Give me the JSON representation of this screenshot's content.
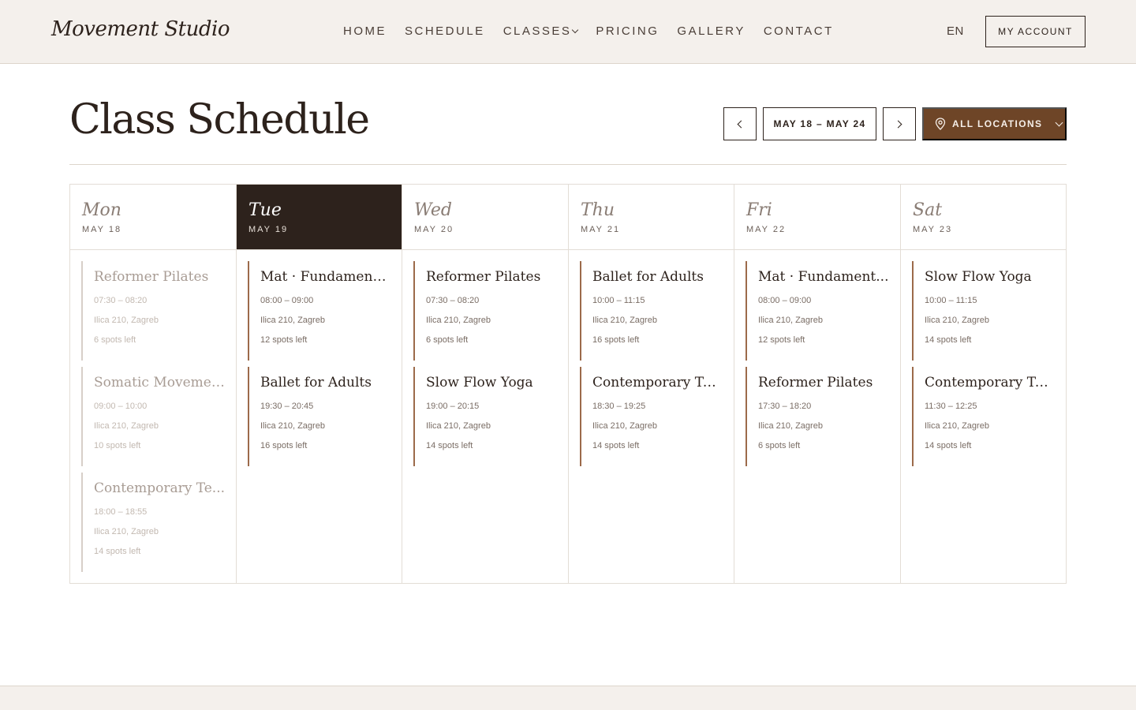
{
  "header": {
    "logo": "Movement Studio",
    "nav": [
      {
        "label": "HOME"
      },
      {
        "label": "SCHEDULE"
      },
      {
        "label": "CLASSES",
        "has_dropdown": true
      },
      {
        "label": "PRICING"
      },
      {
        "label": "GALLERY"
      },
      {
        "label": "CONTACT"
      }
    ],
    "language": "EN",
    "account_label": "MY ACCOUNT"
  },
  "page": {
    "title": "Class Schedule",
    "week_range": "MAY 18 – MAY 24",
    "location_filter": "ALL LOCATIONS",
    "prev_icon": "chevron-left-icon",
    "next_icon": "chevron-right-icon",
    "location_icon": "map-pin-icon"
  },
  "colors": {
    "accent": "#6e4527",
    "active_day_bg": "#2d221c",
    "class_border": "#9c6a4a",
    "header_bg": "#f4f0ec"
  },
  "days": [
    {
      "name": "Mon",
      "date": "MAY 18",
      "active": false,
      "past": true,
      "classes": [
        {
          "title": "Reformer Pilates",
          "time": "07:30 – 08:20",
          "location": "Ilica 210, Zagreb",
          "spots": "6 spots left"
        },
        {
          "title": "Somatic Movement",
          "time": "09:00 – 10:00",
          "location": "Ilica 210, Zagreb",
          "spots": "10 spots left"
        },
        {
          "title": "Contemporary Te...",
          "time": "18:00 – 18:55",
          "location": "Ilica 210, Zagreb",
          "spots": "14 spots left"
        }
      ]
    },
    {
      "name": "Tue",
      "date": "MAY 19",
      "active": true,
      "past": false,
      "classes": [
        {
          "title": "Mat · Fundament...",
          "time": "08:00 – 09:00",
          "location": "Ilica 210, Zagreb",
          "spots": "12 spots left"
        },
        {
          "title": "Ballet for Adults",
          "time": "19:30 – 20:45",
          "location": "Ilica 210, Zagreb",
          "spots": "16 spots left"
        }
      ]
    },
    {
      "name": "Wed",
      "date": "MAY 20",
      "active": false,
      "past": false,
      "classes": [
        {
          "title": "Reformer Pilates",
          "time": "07:30 – 08:20",
          "location": "Ilica 210, Zagreb",
          "spots": "6 spots left"
        },
        {
          "title": "Slow Flow Yoga",
          "time": "19:00 – 20:15",
          "location": "Ilica 210, Zagreb",
          "spots": "14 spots left"
        }
      ]
    },
    {
      "name": "Thu",
      "date": "MAY 21",
      "active": false,
      "past": false,
      "classes": [
        {
          "title": "Ballet for Adults",
          "time": "10:00 – 11:15",
          "location": "Ilica 210, Zagreb",
          "spots": "16 spots left"
        },
        {
          "title": "Contemporary Te...",
          "time": "18:30 – 19:25",
          "location": "Ilica 210, Zagreb",
          "spots": "14 spots left"
        }
      ]
    },
    {
      "name": "Fri",
      "date": "MAY 22",
      "active": false,
      "past": false,
      "classes": [
        {
          "title": "Mat · Fundament...",
          "time": "08:00 – 09:00",
          "location": "Ilica 210, Zagreb",
          "spots": "12 spots left"
        },
        {
          "title": "Reformer Pilates",
          "time": "17:30 – 18:20",
          "location": "Ilica 210, Zagreb",
          "spots": "6 spots left"
        }
      ]
    },
    {
      "name": "Sat",
      "date": "MAY 23",
      "active": false,
      "past": false,
      "classes": [
        {
          "title": "Slow Flow Yoga",
          "time": "10:00 – 11:15",
          "location": "Ilica 210, Zagreb",
          "spots": "14 spots left"
        },
        {
          "title": "Contemporary Te...",
          "time": "11:30 – 12:25",
          "location": "Ilica 210, Zagreb",
          "spots": "14 spots left"
        }
      ]
    }
  ]
}
